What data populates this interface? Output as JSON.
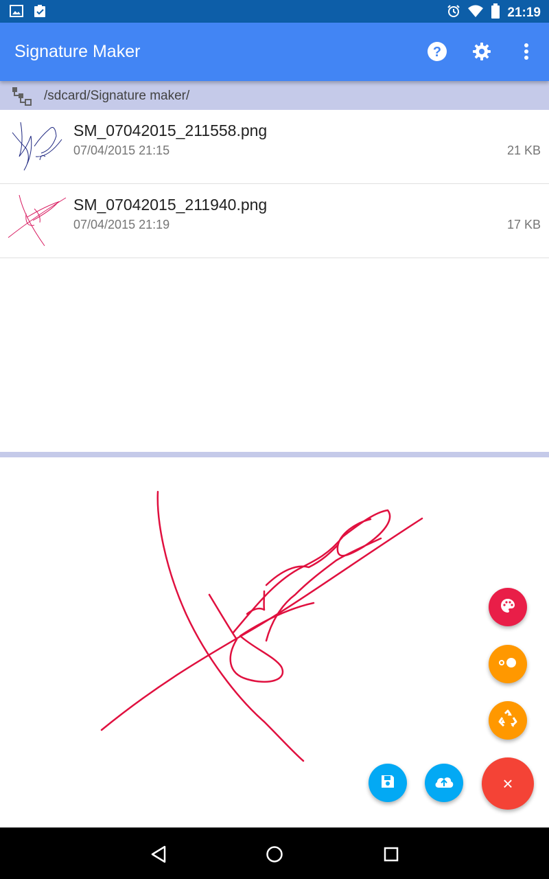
{
  "status_bar": {
    "time": "21:19",
    "icons": [
      "image-icon",
      "clipboard-check-icon",
      "alarm-icon",
      "wifi-icon",
      "battery-icon"
    ]
  },
  "app_bar": {
    "title": "Signature Maker",
    "actions": [
      "help-icon",
      "settings-icon",
      "overflow-menu-icon"
    ],
    "color": "#4285f4"
  },
  "path_bar": {
    "path": "/sdcard/Signature maker/"
  },
  "files": [
    {
      "name": "SM_07042015_211558.png",
      "date": "07/04/2015 21:15",
      "size": "21 KB",
      "ink_color": "#1a237e"
    },
    {
      "name": "SM_07042015_211940.png",
      "date": "07/04/2015 21:19",
      "size": "17 KB",
      "ink_color": "#d81b60"
    }
  ],
  "canvas": {
    "ink_color": "#e0103f"
  },
  "fabs": [
    {
      "name": "palette-icon",
      "color": "#e91e48"
    },
    {
      "name": "stroke-width-icon",
      "color": "#ff9800"
    },
    {
      "name": "recycle-icon",
      "color": "#ff9800"
    },
    {
      "name": "save-icon",
      "color": "#03a9f4"
    },
    {
      "name": "cloud-upload-icon",
      "color": "#03a9f4"
    },
    {
      "name": "close-icon",
      "color": "#f44336",
      "label": "×"
    }
  ],
  "nav_bar": [
    "back-icon",
    "home-icon",
    "recents-icon"
  ]
}
